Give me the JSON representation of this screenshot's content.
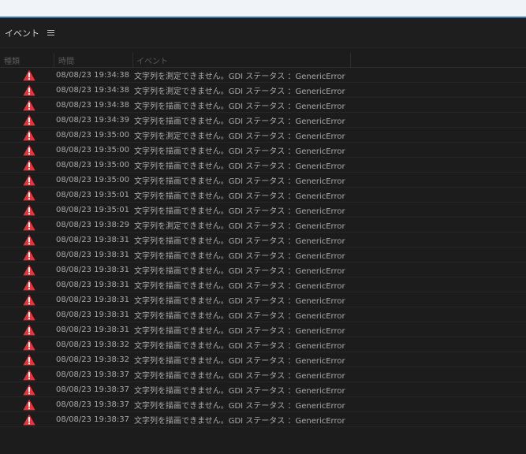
{
  "panel": {
    "title": "イベント"
  },
  "columns": {
    "type": "種類",
    "time": "時間",
    "event": "イベント"
  },
  "colors": {
    "warning": "#e8343a",
    "background": "#1c1c1c",
    "text": "#a9a9a9"
  },
  "rows": [
    {
      "icon": "warning-icon",
      "time": "08/08/23 19:34:38",
      "event": "文字列を測定できません。GDI ステータス ：GenericError"
    },
    {
      "icon": "warning-icon",
      "time": "08/08/23 19:34:38",
      "event": "文字列を測定できません。GDI ステータス ：GenericError"
    },
    {
      "icon": "warning-icon",
      "time": "08/08/23 19:34:38",
      "event": "文字列を描画できません。GDI ステータス ：GenericError"
    },
    {
      "icon": "warning-icon",
      "time": "08/08/23 19:34:39",
      "event": "文字列を描画できません。GDI ステータス ：GenericError"
    },
    {
      "icon": "warning-icon",
      "time": "08/08/23 19:35:00",
      "event": "文字列を測定できません。GDI ステータス ：GenericError"
    },
    {
      "icon": "warning-icon",
      "time": "08/08/23 19:35:00",
      "event": "文字列を描画できません。GDI ステータス ：GenericError"
    },
    {
      "icon": "warning-icon",
      "time": "08/08/23 19:35:00",
      "event": "文字列を描画できません。GDI ステータス ：GenericError"
    },
    {
      "icon": "warning-icon",
      "time": "08/08/23 19:35:00",
      "event": "文字列を描画できません。GDI ステータス ：GenericError"
    },
    {
      "icon": "warning-icon",
      "time": "08/08/23 19:35:01",
      "event": "文字列を描画できません。GDI ステータス ：GenericError"
    },
    {
      "icon": "warning-icon",
      "time": "08/08/23 19:35:01",
      "event": "文字列を描画できません。GDI ステータス ：GenericError"
    },
    {
      "icon": "warning-icon",
      "time": "08/08/23 19:38:29",
      "event": "文字列を測定できません。GDI ステータス ：GenericError"
    },
    {
      "icon": "warning-icon",
      "time": "08/08/23 19:38:31",
      "event": "文字列を描画できません。GDI ステータス ：GenericError"
    },
    {
      "icon": "warning-icon",
      "time": "08/08/23 19:38:31",
      "event": "文字列を描画できません。GDI ステータス ：GenericError"
    },
    {
      "icon": "warning-icon",
      "time": "08/08/23 19:38:31",
      "event": "文字列を描画できません。GDI ステータス ：GenericError"
    },
    {
      "icon": "warning-icon",
      "time": "08/08/23 19:38:31",
      "event": "文字列を描画できません。GDI ステータス ：GenericError"
    },
    {
      "icon": "warning-icon",
      "time": "08/08/23 19:38:31",
      "event": "文字列を描画できません。GDI ステータス ：GenericError"
    },
    {
      "icon": "warning-icon",
      "time": "08/08/23 19:38:31",
      "event": "文字列を描画できません。GDI ステータス ：GenericError"
    },
    {
      "icon": "warning-icon",
      "time": "08/08/23 19:38:31",
      "event": "文字列を描画できません。GDI ステータス ：GenericError"
    },
    {
      "icon": "warning-icon",
      "time": "08/08/23 19:38:32",
      "event": "文字列を描画できません。GDI ステータス ：GenericError"
    },
    {
      "icon": "warning-icon",
      "time": "08/08/23 19:38:32",
      "event": "文字列を描画できません。GDI ステータス ：GenericError"
    },
    {
      "icon": "warning-icon",
      "time": "08/08/23 19:38:37",
      "event": "文字列を描画できません。GDI ステータス ：GenericError"
    },
    {
      "icon": "warning-icon",
      "time": "08/08/23 19:38:37",
      "event": "文字列を描画できません。GDI ステータス ：GenericError"
    },
    {
      "icon": "warning-icon",
      "time": "08/08/23 19:38:37",
      "event": "文字列を描画できません。GDI ステータス ：GenericError"
    },
    {
      "icon": "warning-icon",
      "time": "08/08/23 19:38:37",
      "event": "文字列を描画できません。GDI ステータス ：GenericError"
    }
  ]
}
